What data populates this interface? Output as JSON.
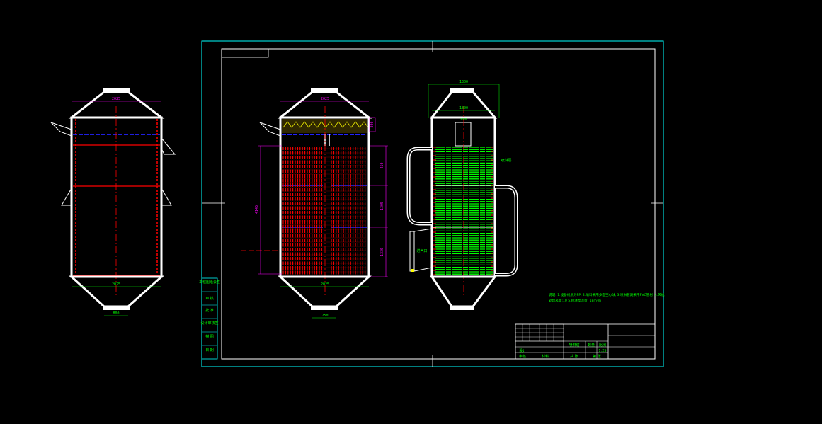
{
  "colors": {
    "background": "#000000",
    "frame": "#00ffff",
    "body": "#ffffff",
    "tubes": "#ff0000",
    "packing": "#00ff00",
    "dimension": "#ff00ff",
    "baffle": "#0000ff",
    "annotation": "#00ff00"
  },
  "views": {
    "left": {
      "dim_top": "2025",
      "dim_bottom": "2025",
      "dim_outlet": "800"
    },
    "middle": {
      "dim_top": "2025",
      "dim_bottom": "2025",
      "dim_outlet": "750",
      "dim_upper_right": "800",
      "dim_vert_1": "450",
      "dim_vert_2": "1305",
      "dim_vert_3": "1330",
      "dim_total": "4145"
    },
    "right": {
      "dim_top": "1300",
      "dim_inner": "1300",
      "dim_sub": "600",
      "side_label": "喷淋层",
      "inlet_label": "进气口"
    }
  },
  "notes": {
    "line1": "说明: 1.设备材质为PP, 2.填料采用多面空心球, 3.喷淋管路采用PVC管材, 4.风机",
    "line2": "处理风量:10          5.喷淋泵流量: 18m³/h"
  },
  "revision_block": [
    "工程图纸会签",
    "审 核",
    "批 准",
    "设计审核签",
    "描 图",
    "日 期"
  ],
  "title_block": {
    "drawing_name": "喷淋塔",
    "quantity": "数量",
    "material": "材料",
    "scale_label": "比例",
    "scale": "1:25",
    "designer": "设计",
    "checker": "审核",
    "sheet": "共 张",
    "page": "第 张"
  }
}
